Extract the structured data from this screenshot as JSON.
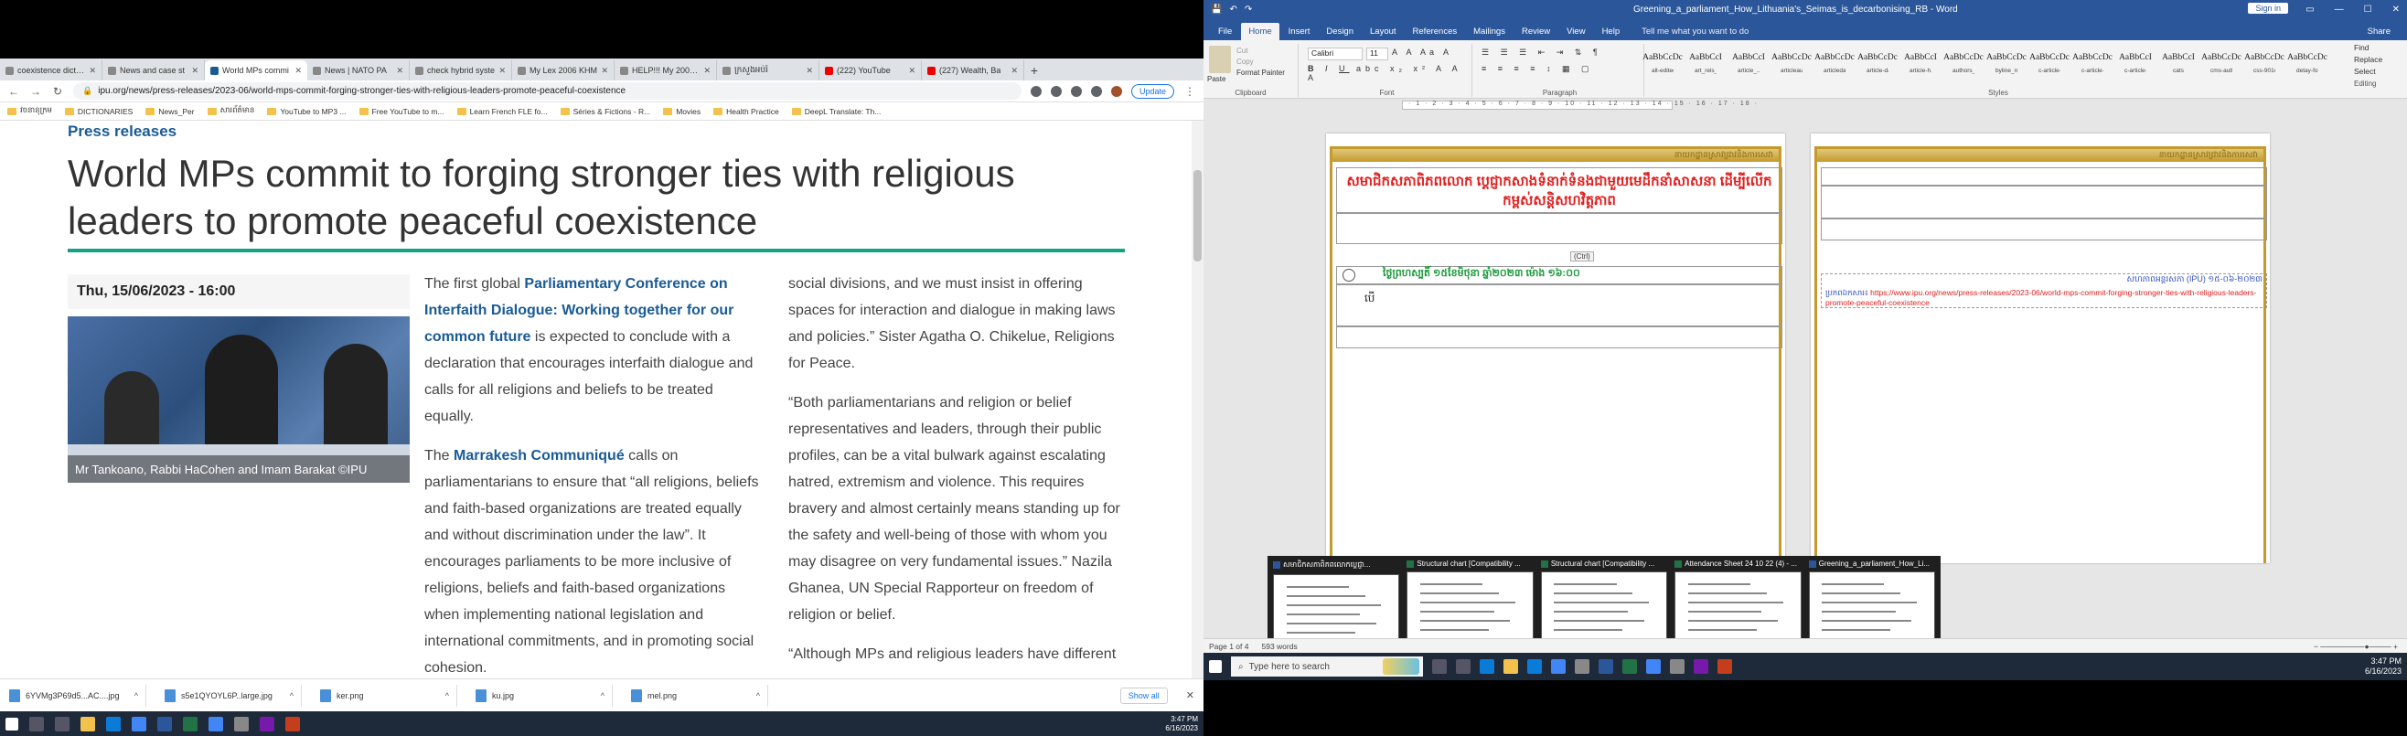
{
  "browser": {
    "tabs": [
      {
        "label": "coexistence dictionar",
        "active": false
      },
      {
        "label": "News and case st",
        "active": false
      },
      {
        "label": "World MPs commi",
        "active": true
      },
      {
        "label": "News | NATO PA",
        "active": false
      },
      {
        "label": "check hybrid syste",
        "active": false
      },
      {
        "label": "My Lex 2006 KHM",
        "active": false
      },
      {
        "label": "HELP!!! My 2006 Lex",
        "active": false
      },
      {
        "label": "ក្រសួងអប់រំ",
        "active": false
      },
      {
        "label": "(222) YouTube",
        "active": false
      },
      {
        "label": "(227) Wealth, Ba",
        "active": false
      }
    ],
    "url": "ipu.org/news/press-releases/2023-06/world-mps-commit-forging-stronger-ties-with-religious-leaders-promote-peaceful-coexistence",
    "update_label": "Update",
    "bookmarks": [
      "វចនានុក្រម",
      "DICTIONARIES",
      "News_Per",
      "សារព័ត៌មាន",
      "YouTube to MP3 ...",
      "Free YouTube to m...",
      "Learn French FLE fo...",
      "Séries & Fictions - R...",
      "Movies",
      "Health Practice",
      "DeepL Translate: Th..."
    ],
    "article": {
      "section": "Press releases",
      "headline": "World MPs commit to forging stronger ties with religious leaders to promote peaceful coexistence",
      "date": "Thu, 15/06/2023 - 16:00",
      "caption": "Mr Tankoano,  Rabbi HaCohen and Imam Barakat  ©IPU",
      "p1_pre": "The first global ",
      "p1_link": "Parliamentary Conference on Interfaith Dialogue: Working together for our common future",
      "p1_post": " is expected to conclude with a declaration that encourages interfaith dialogue and calls for all religions and beliefs to be treated equally.",
      "p2_pre": "The ",
      "p2_link": "Marrakesh Communiqué",
      "p2_post": " calls on parliamentarians to ensure that “all religions, beliefs and faith-based organizations are treated equally and without discrimination under the law”. It encourages parliaments to be more inclusive of religions, beliefs and faith-based organizations when implementing national legislation and international commitments, and in promoting social cohesion.",
      "c2_p1": "social divisions, and we must insist in offering spaces for interaction and dialogue in making laws and policies.” Sister Agatha O. Chikelue, Religions for Peace.",
      "c2_p2": "“Both parliamentarians and religion or belief representatives and leaders, through their public profiles, can be a vital bulwark against escalating hatred, extremism and violence. This requires bravery and almost certainly means standing up for the safety and well-being of those with whom you may disagree on very fundamental issues.” Nazila Ghanea, UN Special Rapporteur on freedom of religion or belief.",
      "c2_p3": "“Although MPs and religious leaders have different"
    },
    "downloads": [
      "6YVMg3P69d5...AC....jpg",
      "s5e1QYOYL6P..large.jpg",
      "ker.png",
      "ku.jpg",
      "mel.png"
    ],
    "show_all": "Show all",
    "clock": {
      "time": "3:47 PM",
      "date": "6/16/2023"
    }
  },
  "word": {
    "title": "Greening_a_parliament_How_Lithuania's_Seimas_is_decarbonising_RB - Word",
    "sign_in": "Sign in",
    "menu": [
      "File",
      "Home",
      "Insert",
      "Design",
      "Layout",
      "References",
      "Mailings",
      "Review",
      "View",
      "Help"
    ],
    "tell_me": "Tell me what you want to do",
    "share": "Share",
    "clipboard": {
      "paste": "Paste",
      "cut": "Cut",
      "copy": "Copy",
      "format_painter": "Format Painter",
      "label": "Clipboard"
    },
    "font": {
      "name": "Calibri",
      "size": "11",
      "label": "Font"
    },
    "paragraph_label": "Paragraph",
    "styles_label": "Styles",
    "styles": [
      {
        "sample": "AaBbCcDc",
        "name": "alt-edited"
      },
      {
        "sample": "AaBbCcI",
        "name": "art_rels_..."
      },
      {
        "sample": "AaBbCcI",
        "name": "article_..."
      },
      {
        "sample": "AaBbCcDc",
        "name": "articleaut..."
      },
      {
        "sample": "AaBbCcDc",
        "name": "articledate"
      },
      {
        "sample": "AaBbCcDc",
        "name": "article-date"
      },
      {
        "sample": "AaBbCcI",
        "name": "article-h..."
      },
      {
        "sample": "AaBbCcDc",
        "name": "authors_..."
      },
      {
        "sample": "AaBbCcDc",
        "name": "byline_na..."
      },
      {
        "sample": "AaBbCcDc",
        "name": "c-article-..."
      },
      {
        "sample": "AaBbCcDc",
        "name": "c-article-d..."
      },
      {
        "sample": "AaBbCcI",
        "name": "c-article-..."
      },
      {
        "sample": "AaBbCcI",
        "name": "cats"
      },
      {
        "sample": "AaBbCcDc",
        "name": "cms-author"
      },
      {
        "sample": "AaBbCcDc",
        "name": "css-901oao"
      },
      {
        "sample": "AaBbCcDc",
        "name": "detay-fot..."
      }
    ],
    "editing": {
      "find": "Find",
      "replace": "Replace",
      "select": "Select",
      "label": "Editing"
    },
    "page1": {
      "header": "នាយកដ្ឋានស្រាវជ្រាវនិងការសេវា",
      "title": "សមាជិកសភាពិភពលោក ប្តេជ្ញាកសាងទំនាក់ទំនងជាមួយមេដឹកនាំសាសនា ដើម្បីលើកកម្ពស់សន្តិសហវិត្តភាព",
      "paste_badge": "(Ctrl)",
      "green_line": "ថ្ងៃព្រហស្បតិ៍ ១៥ខែមិថុនា ឆ្នាំ២០២៣ ម៉ោង ១៦:០០",
      "body_char": "បើ"
    },
    "page2": {
      "header": "នាយកដ្ឋានស្រាវជ្រាវនិងការសេវា",
      "blue_line": "សហភាពអន្តរសភា (IPU) ១៥-០៦-២០២៣",
      "red_label": "ប្រភពឯកសារ៖",
      "red_link": "https://www.ipu.org/news/press-releases/2023-06/world-mps-commit-forging-stronger-ties-with-religious-leaders-promote-peaceful-coexistence"
    },
    "previews": [
      {
        "title": "សមាជិកសភាពិភពលោកប្តេជ្ញា...",
        "app": "word"
      },
      {
        "title": "Structural chart [Compatibility ...",
        "app": "excel"
      },
      {
        "title": "Structural chart [Compatibility ...",
        "app": "excel"
      },
      {
        "title": "Attendance Sheet 24 10 22 (4) - ...",
        "app": "excel"
      },
      {
        "title": "Greening_a_parliament_How_Li...",
        "app": "word"
      }
    ],
    "status": {
      "page": "Page 1 of 4",
      "words": "593 words"
    },
    "search_placeholder": "Type here to search",
    "clock": {
      "time": "3:47 PM",
      "date": "6/16/2023"
    }
  }
}
